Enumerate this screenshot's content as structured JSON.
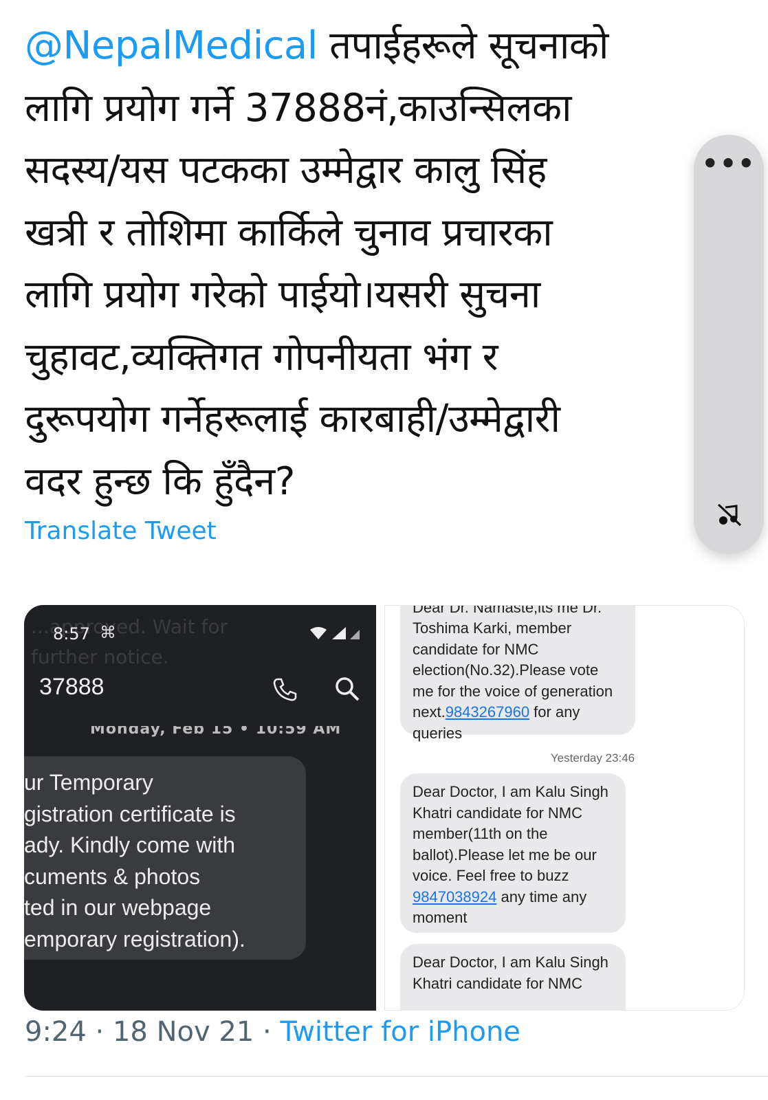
{
  "tweet": {
    "mention": "@NepalMedical",
    "text": " तपाईहरूले सूचनाको\nलागि प्रयोग गर्ने 37888नं,काउन्सिलका\nसदस्य/यस पटकका उम्मेद्वार कालु सिंह\nखत्री र तोशिमा कार्किले चुनाव प्रचारका\nलागि प्रयोग गरेको पाईयो।यसरी सुचना\nचुहावट,व्यक्तिगत गोपनीयता भंग र\nदुरूपयोग गर्नेहरूलाई कारबाही/उम्मेद्वारी\nवदर हुन्छ कि हुँदैन?",
    "translate_label": "Translate Tweet"
  },
  "side_controls": {
    "more_icon": "more-horizontal-icon",
    "more_label": "•••",
    "mute_icon": "mute-icon"
  },
  "media": {
    "left_screenshot": {
      "status_time": "8:57",
      "status_icon": "⌘",
      "ghost_text": "...approved. Wait for\nfurther notice.",
      "sender": "37888",
      "date_separator": "Monday, Feb 15 • 10:59 AM",
      "message": "ur Temporary\ngistration certificate is\nady. Kindly come with\ncuments & photos\nted in our webpage\nemporary registration)."
    },
    "right_screenshot": {
      "msg1_cut": "Dear Dr. Namaste,its me Dr.",
      "msg1_a": "Toshima Karki, member\ncandidate for NMC\nelection(No.32).Please vote\nme for the voice of generation\nnext.",
      "msg1_link": "9843267960",
      "msg1_b": " for any\nqueries",
      "timestamp": "Yesterday 23:46",
      "msg2_a": "Dear Doctor, I am Kalu Singh\nKhatri candidate for NMC\nmember(11th on the\nballot).Please let me be our\nvoice. Feel free to buzz\n",
      "msg2_link": "9847038924",
      "msg2_b": " any time any\nmoment",
      "msg3": "Dear Doctor, I am Kalu Singh\nKhatri candidate for NMC"
    }
  },
  "meta": {
    "time_date": "9:24 · 18 Nov 21 · ",
    "source": "Twitter for iPhone"
  },
  "colors": {
    "accent": "#1d9bf0",
    "dark_bg": "#1f2023",
    "bubble_gray": "#e9e9eb"
  }
}
